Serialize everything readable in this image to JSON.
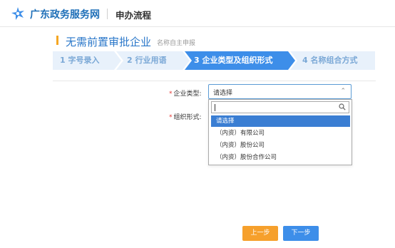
{
  "header": {
    "site_name": "广东政务服务网",
    "section_title": "申办流程",
    "logo_icon": "guangdong-service-logo-icon"
  },
  "page": {
    "title": "无需前置审批企业",
    "subtitle": "名称自主申报"
  },
  "steps": [
    {
      "label": "1 字号录入",
      "active": false
    },
    {
      "label": "2 行业用语",
      "active": false
    },
    {
      "label": "3 企业类型及组织形式",
      "active": true
    },
    {
      "label": "4 名称组合方式",
      "active": false
    }
  ],
  "form": {
    "enterprise_type": {
      "label": "企业类型:",
      "value": "请选择",
      "search_value": "",
      "options": [
        {
          "label": "请选择",
          "selected": true
        },
        {
          "label": "（内资）有限公司",
          "selected": false
        },
        {
          "label": "（内资）股份公司",
          "selected": false
        },
        {
          "label": "（内资）股份合作公司",
          "selected": false
        }
      ]
    },
    "org_form": {
      "label": "组织形式:"
    },
    "required_mark": "*"
  },
  "buttons": {
    "prev": "上一步",
    "next": "下一步"
  },
  "colors": {
    "brand_blue": "#2a77c9",
    "step_inactive_bg": "#e8f1fb",
    "step_active_bg": "#3d8ee9",
    "accent_orange": "#f6a02c",
    "required_red": "#e53935"
  }
}
